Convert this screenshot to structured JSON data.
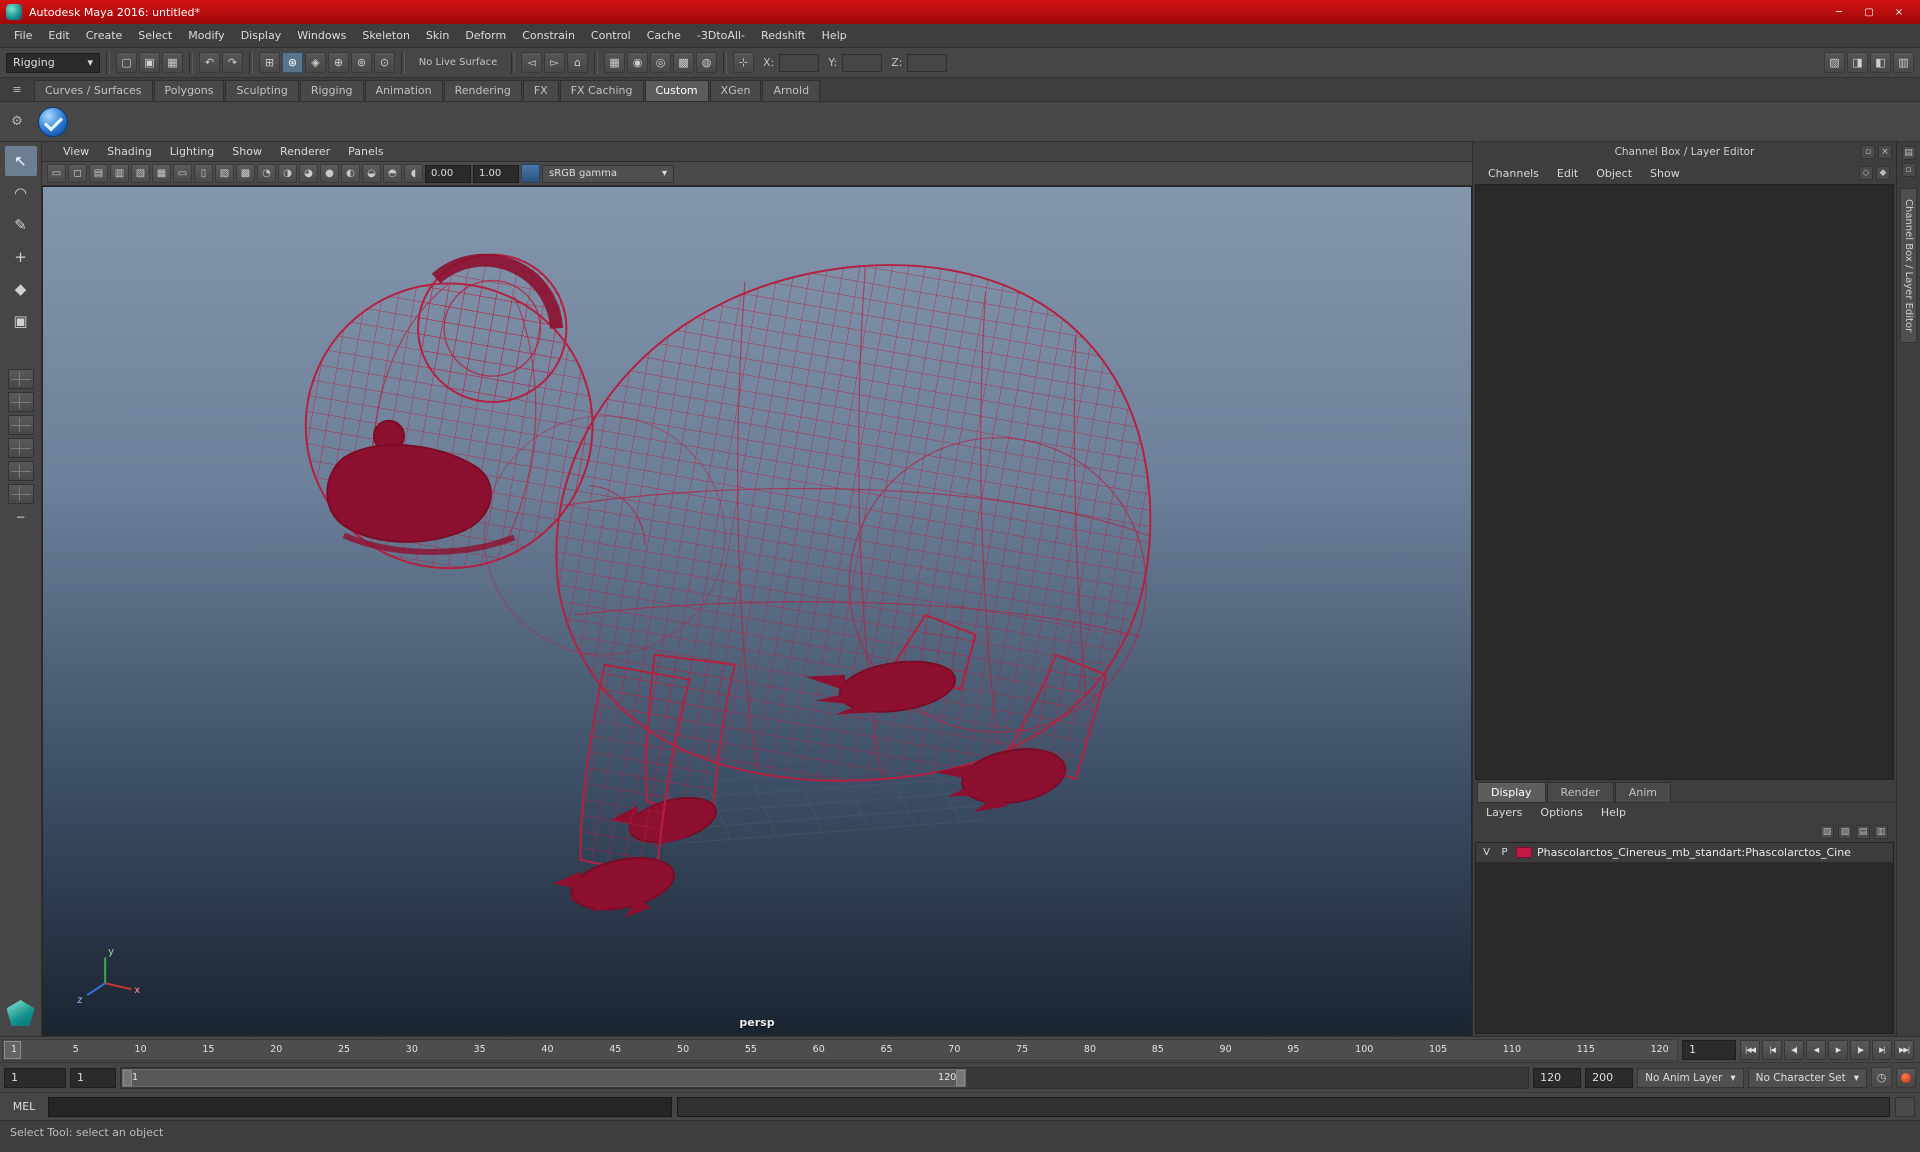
{
  "colors": {
    "titlebar_red": "#c01010",
    "wireframe_red": "#b62040",
    "wireframe_dark_red": "#8e1030",
    "viewport_top": "#8496ac",
    "viewport_bottom": "#1a2431",
    "layer_swatch_red": "#c21747"
  },
  "titlebar": {
    "title": "Autodesk Maya 2016: untitled*",
    "minimize": "─",
    "maximize": "▢",
    "close": "×"
  },
  "menubar": {
    "items": [
      "File",
      "Edit",
      "Create",
      "Select",
      "Modify",
      "Display",
      "Windows",
      "Skeleton",
      "Skin",
      "Deform",
      "Constrain",
      "Control",
      "Cache",
      "-3DtoAll-",
      "Redshift",
      "Help"
    ]
  },
  "statusline": {
    "menuset": "Rigging",
    "menuset_arrow": "▾",
    "file_icons": [
      {
        "name": "new-scene-icon",
        "glyph": "▢"
      },
      {
        "name": "open-scene-icon",
        "glyph": "▣"
      },
      {
        "name": "save-scene-icon",
        "glyph": "▦"
      }
    ],
    "undo_icons": [
      {
        "name": "undo-icon",
        "glyph": "↶"
      },
      {
        "name": "redo-icon",
        "glyph": "↷"
      }
    ],
    "snap_icons": [
      {
        "name": "snap-to-grids-icon",
        "glyph": "⊞"
      },
      {
        "name": "snap-to-curves-icon",
        "glyph": "⊛",
        "active": true
      },
      {
        "name": "snap-to-points-icon",
        "glyph": "◈"
      },
      {
        "name": "snap-to-projected-center-icon",
        "glyph": "⊕"
      },
      {
        "name": "snap-to-view-planes-icon",
        "glyph": "⊚"
      },
      {
        "name": "make-live-icon",
        "glyph": "⊙"
      }
    ],
    "live_surface": "No Live Surface",
    "history_icons": [
      {
        "name": "input-connections-icon",
        "glyph": "◅"
      },
      {
        "name": "output-connections-icon",
        "glyph": "▻"
      },
      {
        "name": "construction-history-icon",
        "glyph": "⌂"
      }
    ],
    "render_icons": [
      {
        "name": "render-view-icon",
        "glyph": "▦"
      },
      {
        "name": "render-current-frame-icon",
        "glyph": "◉"
      },
      {
        "name": "ipr-render-icon",
        "glyph": "◎"
      },
      {
        "name": "render-settings-icon",
        "glyph": "▩"
      },
      {
        "name": "hypershade-icon",
        "glyph": "◍"
      }
    ],
    "grid_glyph": "⊹",
    "x_label": "X:",
    "y_label": "Y:",
    "z_label": "Z:",
    "sidebar_toggle_icons": [
      {
        "name": "modeling-toolkit-toggle-icon",
        "glyph": "▨"
      },
      {
        "name": "attribute-editor-toggle-icon",
        "glyph": "◨"
      },
      {
        "name": "tool-settings-toggle-icon",
        "glyph": "◧"
      },
      {
        "name": "channel-box-toggle-icon",
        "glyph": "▥"
      }
    ]
  },
  "shelf": {
    "menu_glyph": "≡",
    "gear_glyph": "⚙",
    "tabs": [
      {
        "label": "Curves / Surfaces"
      },
      {
        "label": "Polygons"
      },
      {
        "label": "Sculpting"
      },
      {
        "label": "Rigging"
      },
      {
        "label": "Animation"
      },
      {
        "label": "Rendering"
      },
      {
        "label": "FX"
      },
      {
        "label": "FX Caching"
      },
      {
        "label": "Custom",
        "active": true
      },
      {
        "label": "XGen"
      },
      {
        "label": "Arnold"
      }
    ]
  },
  "toolbox": {
    "tools": [
      {
        "name": "select-tool",
        "glyph": "↖",
        "active": true
      },
      {
        "name": "lasso-select-tool",
        "glyph": "◠"
      },
      {
        "name": "paint-select-tool",
        "glyph": "✎"
      },
      {
        "name": "move-tool",
        "glyph": "+"
      },
      {
        "name": "rotate-tool",
        "glyph": "◆"
      },
      {
        "name": "scale-tool",
        "glyph": "▣"
      }
    ],
    "layouts": [
      {
        "name": "layout-single-perspective-button"
      },
      {
        "name": "layout-four-view-button"
      },
      {
        "name": "layout-persp-outliner-button"
      },
      {
        "name": "layout-persp-graph-button"
      },
      {
        "name": "layout-hypershade-persp-button"
      },
      {
        "name": "layout-persp-uv-button"
      }
    ],
    "collapse_glyph": "−"
  },
  "panel_menus": {
    "items": [
      "View",
      "Shading",
      "Lighting",
      "Show",
      "Renderer",
      "Panels"
    ]
  },
  "viewport_bar": {
    "icons": [
      {
        "name": "select-camera-icon",
        "glyph": "▭"
      },
      {
        "name": "camera-attributes-icon",
        "glyph": "◻"
      },
      {
        "name": "bookmarks-icon",
        "glyph": "▤"
      },
      {
        "name": "image-plane-icon",
        "glyph": "▥"
      },
      {
        "name": "2d-pan-zoom-icon",
        "glyph": "▧"
      },
      {
        "name": "grid-toggle-icon",
        "glyph": "▦"
      },
      {
        "name": "film-gate-icon",
        "glyph": "▭"
      },
      {
        "name": "resolution-gate-icon",
        "glyph": "▯"
      },
      {
        "name": "gate-mask-icon",
        "glyph": "▨"
      },
      {
        "name": "field-chart-icon",
        "glyph": "▩"
      },
      {
        "name": "wireframe-mode-icon",
        "glyph": "◔"
      },
      {
        "name": "shaded-mode-icon",
        "glyph": "◑"
      },
      {
        "name": "textured-mode-icon",
        "glyph": "◕"
      },
      {
        "name": "all-lights-icon",
        "glyph": "●"
      },
      {
        "name": "shadows-icon",
        "glyph": "◐"
      },
      {
        "name": "ambient-occlusion-icon",
        "glyph": "◒"
      },
      {
        "name": "motion-blur-icon",
        "glyph": "◓"
      },
      {
        "name": "xray-icon",
        "glyph": "◖"
      }
    ],
    "exposure": "0.00",
    "gamma": "1.00",
    "colorspace": "sRGB gamma",
    "arrow": "▾"
  },
  "viewport": {
    "camera": "persp"
  },
  "sidebar": {
    "header": "Channel Box / Layer Editor",
    "header_icons": [
      {
        "name": "dock-panel-icon",
        "glyph": "▫"
      },
      {
        "name": "close-panel-icon",
        "glyph": "×"
      }
    ],
    "menus": [
      "Channels",
      "Edit",
      "Object",
      "Show"
    ],
    "menu_right_icons": [
      {
        "name": "manip-state-icon",
        "glyph": "◇"
      },
      {
        "name": "speed-state-icon",
        "glyph": "◆"
      }
    ],
    "layer_editor": {
      "tabs": [
        {
          "label": "Display",
          "active": true
        },
        {
          "label": "Render"
        },
        {
          "label": "Anim"
        }
      ],
      "menus": [
        "Layers",
        "Options",
        "Help"
      ],
      "icons": [
        {
          "name": "add-empty-layer-icon",
          "glyph": "▧"
        },
        {
          "name": "add-layer-from-selected-icon",
          "glyph": "▨"
        },
        {
          "name": "move-layer-up-icon",
          "glyph": "▤"
        },
        {
          "name": "move-layer-down-icon",
          "glyph": "▥"
        }
      ],
      "layer_row": {
        "visibility": "V",
        "playback": "P",
        "name": "Phascolarctos_Cinereus_mb_standart:Phascolarctos_Cine"
      }
    }
  },
  "right_strip": {
    "icons": [
      {
        "name": "panel-menu-icon",
        "glyph": "▤"
      },
      {
        "name": "panel-float-icon",
        "glyph": "▫"
      }
    ],
    "tab": "Channel Box / Layer Editor"
  },
  "timeline": {
    "ticks": [
      "1",
      "5",
      "10",
      "15",
      "20",
      "25",
      "30",
      "35",
      "40",
      "45",
      "50",
      "55",
      "60",
      "65",
      "70",
      "75",
      "80",
      "85",
      "90",
      "95",
      "100",
      "105",
      "110",
      "115",
      "120"
    ],
    "current_frame": "1",
    "playback": [
      {
        "name": "go-to-start-button",
        "glyph": "|◀◀"
      },
      {
        "name": "step-back-frame-button",
        "glyph": "|◀"
      },
      {
        "name": "step-back-key-button",
        "glyph": "◀|"
      },
      {
        "name": "play-backwards-button",
        "glyph": "◀"
      },
      {
        "name": "play-forwards-button",
        "glyph": "▶"
      },
      {
        "name": "step-forward-key-button",
        "glyph": "|▶"
      },
      {
        "name": "step-forward-frame-button",
        "glyph": "▶|"
      },
      {
        "name": "go-to-end-button",
        "glyph": "▶▶|"
      }
    ]
  },
  "range_slider": {
    "anim_start": "1",
    "playback_start": "1",
    "inner_start": "1",
    "inner_end": "120",
    "playback_end": "120",
    "anim_end": "200",
    "anim_layer": "No Anim Layer",
    "character_set": "No Character Set",
    "clock_glyph": "◷",
    "arrow": "▾"
  },
  "command_line": {
    "label": "MEL"
  },
  "help_line": {
    "text": "Select Tool: select an object"
  }
}
